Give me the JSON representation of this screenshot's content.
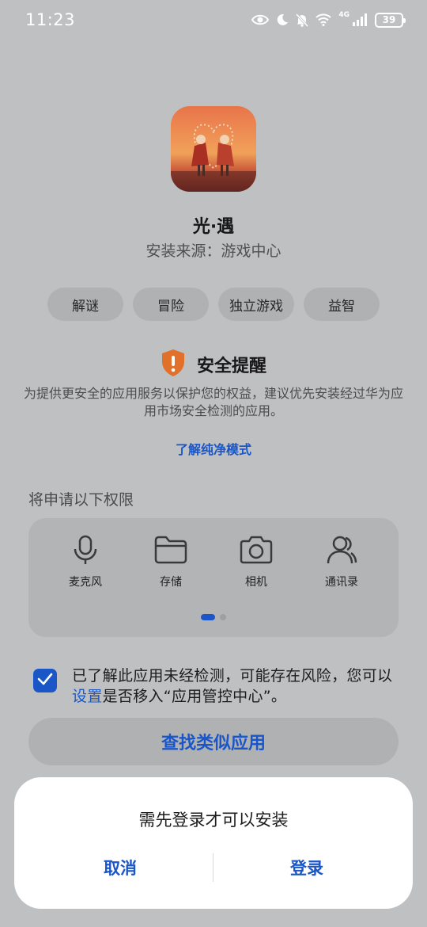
{
  "status_bar": {
    "time": "11:23",
    "network": "4G",
    "battery": "39"
  },
  "app": {
    "name": "光·遇",
    "source": "安装来源：游戏中心"
  },
  "tags": [
    "解谜",
    "冒险",
    "独立游戏",
    "益智"
  ],
  "safety": {
    "title": "安全提醒",
    "description": "为提供更安全的应用服务以保护您的权益，建议优先安装经过华为应用市场安全检测的应用。",
    "learn_link": "了解纯净模式"
  },
  "permissions": {
    "title": "将申请以下权限",
    "items": [
      {
        "label": "麦克风",
        "icon": "microphone-icon"
      },
      {
        "label": "存储",
        "icon": "folder-icon"
      },
      {
        "label": "相机",
        "icon": "camera-icon"
      },
      {
        "label": "通讯录",
        "icon": "contacts-icon"
      }
    ],
    "page_count": 2,
    "current_page": 1
  },
  "consent": {
    "checked": true,
    "text_before": "已了解此应用未经检测，可能存在风险，您可以",
    "link": "设置",
    "text_after": "是否移入“应用管控中心”。"
  },
  "find_similar": "查找类似应用",
  "dialog": {
    "message": "需先登录才可以安装",
    "cancel": "取消",
    "confirm": "登录"
  },
  "colors": {
    "accent": "#1a56c7",
    "warning": "#e0702a",
    "background_dimmed": "#bfc0c2"
  }
}
